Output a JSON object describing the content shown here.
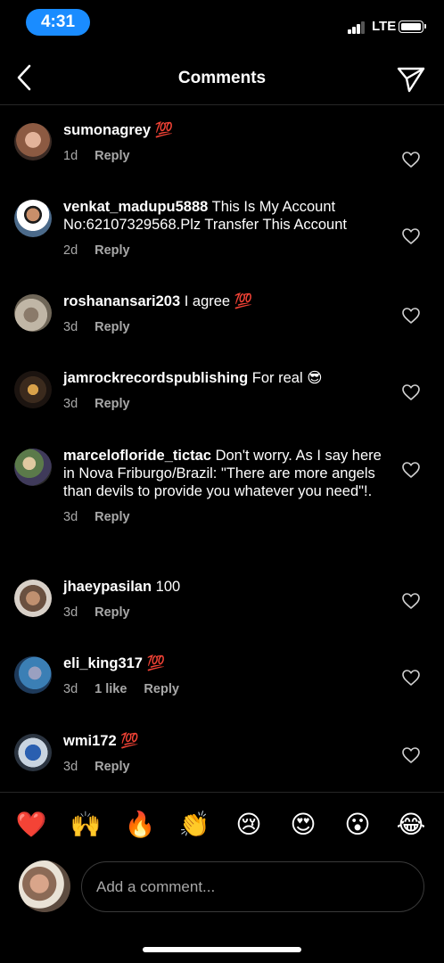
{
  "status_bar": {
    "time": "4:31",
    "network": "LTE"
  },
  "header": {
    "title": "Comments",
    "back_icon": "chevron-left-icon",
    "send_icon": "paper-plane-icon"
  },
  "comments": [
    {
      "username": "sumonagrey",
      "text": " 💯",
      "age": "1d",
      "likes": "",
      "reply": "Reply"
    },
    {
      "username": "venkat_madupu5888",
      "text": " This Is My Account No:62107329568.Plz Transfer This Account",
      "age": "2d",
      "likes": "",
      "reply": "Reply"
    },
    {
      "username": "roshanansari203",
      "text": " I agree 💯",
      "age": "3d",
      "likes": "",
      "reply": "Reply"
    },
    {
      "username": "jamrockrecordspublishing",
      "text": " For real 😎",
      "age": "3d",
      "likes": "",
      "reply": "Reply"
    },
    {
      "username": "marcelofloride_tictac",
      "text": " Don't worry. As I say here in Nova Friburgo/Brazil: \"There are more angels than devils to provide you whatever you need\"!.",
      "age": "3d",
      "likes": "",
      "reply": "Reply"
    },
    {
      "username": "jhaeypasilan",
      "text": " 100",
      "age": "3d",
      "likes": "",
      "reply": "Reply"
    },
    {
      "username": "eli_king317",
      "text": " 💯",
      "age": "3d",
      "likes": "1 like",
      "reply": "Reply"
    },
    {
      "username": "wmi172",
      "text": " 💯",
      "age": "3d",
      "likes": "",
      "reply": "Reply"
    }
  ],
  "emoji_bar": [
    "❤️",
    "🙌",
    "🔥",
    "👏",
    "😢",
    "😍",
    "😮",
    "😂"
  ],
  "input": {
    "placeholder": "Add a comment..."
  }
}
